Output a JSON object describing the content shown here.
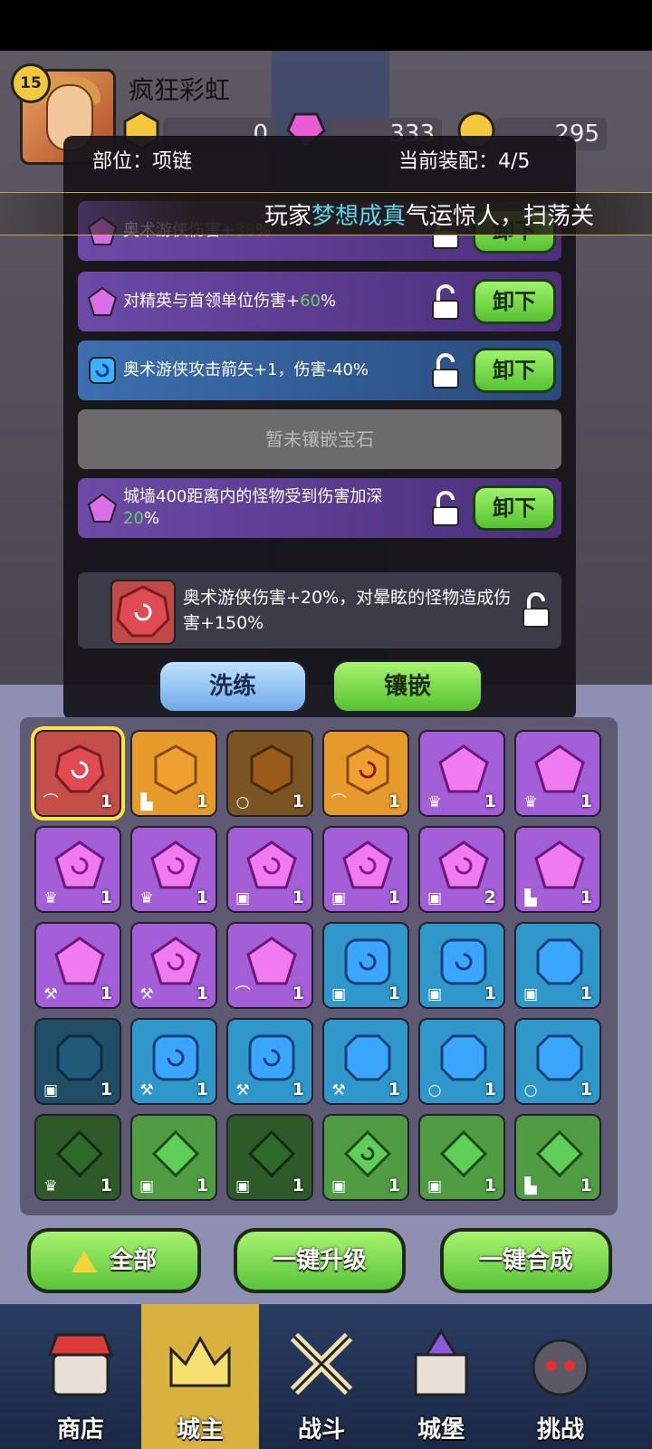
{
  "player": {
    "name": "疯狂彩虹",
    "level": "15"
  },
  "resources": [
    {
      "name": "gold-coin",
      "value": "0",
      "color": "#f3c83a"
    },
    {
      "name": "pink-gem",
      "value": "333",
      "color": "#e85ad6"
    },
    {
      "name": "trophy",
      "value": "295",
      "color": "#f3c83a"
    }
  ],
  "modal": {
    "slot_label": "部位：项链",
    "equip_count": "当前装配：4/5",
    "rows": [
      {
        "text_a": "奥术游侠伤害+",
        "text_hl": "38",
        "text_b": "%",
        "btn": "卸下"
      },
      {
        "text_a": "对精英与首领单位伤害+",
        "text_hl": "60",
        "text_b": "%",
        "btn": "卸下"
      },
      {
        "text_a": "奥术游侠攻击箭矢+1，伤害-40%",
        "text_hl": "",
        "text_b": "",
        "btn": "卸下"
      },
      {
        "text_a": "暂未镶嵌宝石",
        "text_hl": "",
        "text_b": "",
        "btn": ""
      },
      {
        "text_a": "城墙400距离内的怪物受到伤害加深",
        "text_hl": "20",
        "text_b": "%",
        "btn": "卸下"
      }
    ],
    "selected_gem_text": "奥术游侠伤害+20%，对晕眩的怪物造成伤害+150%",
    "refine_label": "洗练",
    "inlay_label": "镶嵌"
  },
  "ticker": {
    "prefix": "玩家",
    "highlight": "梦想成真",
    "suffix": "气运惊人，扫荡关"
  },
  "inventory": [
    [
      "1",
      "1",
      "1",
      "1",
      "1",
      "1"
    ],
    [
      "1",
      "1",
      "1",
      "1",
      "2",
      "1"
    ],
    [
      "1",
      "1",
      "1",
      "1",
      "1",
      "1"
    ],
    [
      "1",
      "1",
      "1",
      "1",
      "1",
      "1"
    ],
    [
      "1",
      "1",
      "1",
      "1",
      "1",
      "1"
    ]
  ],
  "actions": {
    "all": "全部",
    "upgrade": "一键升级",
    "merge": "一键合成"
  },
  "nav": [
    {
      "label": "商店",
      "icon": "shop-icon"
    },
    {
      "label": "城主",
      "icon": "crown-icon"
    },
    {
      "label": "战斗",
      "icon": "swords-icon"
    },
    {
      "label": "城堡",
      "icon": "castle-icon"
    },
    {
      "label": "挑战",
      "icon": "demon-icon"
    }
  ]
}
